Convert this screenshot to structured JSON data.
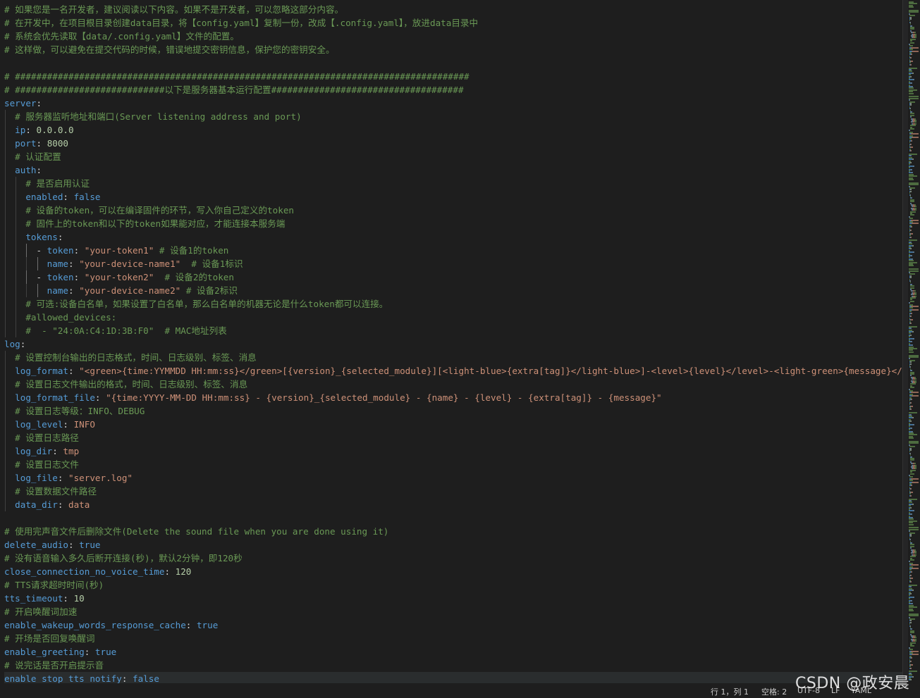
{
  "lines": [
    {
      "indent": 0,
      "guides": [],
      "tokens": [
        {
          "t": "comment",
          "v": "# 如果您是一名开发者，建议阅读以下内容。如果不是开发者，可以忽略这部分内容。"
        }
      ]
    },
    {
      "indent": 0,
      "guides": [],
      "tokens": [
        {
          "t": "comment",
          "v": "# 在开发中，在项目根目录创建data目录，将【config.yaml】复制一份，改成【.config.yaml】，放进data目录中"
        }
      ]
    },
    {
      "indent": 0,
      "guides": [],
      "tokens": [
        {
          "t": "comment",
          "v": "# 系统会优先读取【data/.config.yaml】文件的配置。"
        }
      ]
    },
    {
      "indent": 0,
      "guides": [],
      "tokens": [
        {
          "t": "comment",
          "v": "# 这样做，可以避免在提交代码的时候，错误地提交密钥信息，保护您的密钥安全。"
        }
      ]
    },
    {
      "indent": 0,
      "guides": [],
      "tokens": []
    },
    {
      "indent": 0,
      "guides": [],
      "tokens": [
        {
          "t": "comment",
          "v": "# #####################################################################################"
        }
      ]
    },
    {
      "indent": 0,
      "guides": [],
      "tokens": [
        {
          "t": "comment",
          "v": "# ############################以下是服务器基本运行配置####################################"
        }
      ]
    },
    {
      "indent": 0,
      "guides": [],
      "tokens": [
        {
          "t": "key",
          "v": "server"
        },
        {
          "t": "punct",
          "v": ":"
        }
      ]
    },
    {
      "indent": 2,
      "guides": [
        0
      ],
      "tokens": [
        {
          "t": "comment",
          "v": "# 服务器监听地址和端口(Server listening address and port)"
        }
      ]
    },
    {
      "indent": 2,
      "guides": [
        0
      ],
      "tokens": [
        {
          "t": "key",
          "v": "ip"
        },
        {
          "t": "punct",
          "v": ": "
        },
        {
          "t": "num",
          "v": "0.0.0.0"
        }
      ]
    },
    {
      "indent": 2,
      "guides": [
        0
      ],
      "tokens": [
        {
          "t": "key",
          "v": "port"
        },
        {
          "t": "punct",
          "v": ": "
        },
        {
          "t": "num",
          "v": "8000"
        }
      ]
    },
    {
      "indent": 2,
      "guides": [
        0
      ],
      "tokens": [
        {
          "t": "comment",
          "v": "# 认证配置"
        }
      ]
    },
    {
      "indent": 2,
      "guides": [
        0
      ],
      "tokens": [
        {
          "t": "key",
          "v": "auth"
        },
        {
          "t": "punct",
          "v": ":"
        }
      ]
    },
    {
      "indent": 4,
      "guides": [
        0,
        2
      ],
      "tokens": [
        {
          "t": "comment",
          "v": "# 是否启用认证"
        }
      ]
    },
    {
      "indent": 4,
      "guides": [
        0,
        2
      ],
      "tokens": [
        {
          "t": "key",
          "v": "enabled"
        },
        {
          "t": "punct",
          "v": ": "
        },
        {
          "t": "bool",
          "v": "false"
        }
      ]
    },
    {
      "indent": 4,
      "guides": [
        0,
        2
      ],
      "tokens": [
        {
          "t": "comment",
          "v": "# 设备的token，可以在编译固件的环节，写入你自己定义的token"
        }
      ]
    },
    {
      "indent": 4,
      "guides": [
        0,
        2
      ],
      "tokens": [
        {
          "t": "comment",
          "v": "# 固件上的token和以下的token如果能对应，才能连接本服务端"
        }
      ]
    },
    {
      "indent": 4,
      "guides": [
        0,
        2
      ],
      "tokens": [
        {
          "t": "key",
          "v": "tokens"
        },
        {
          "t": "punct",
          "v": ":"
        }
      ]
    },
    {
      "indent": 6,
      "guides": [
        0,
        2,
        4
      ],
      "tokens": [
        {
          "t": "dash",
          "v": "- "
        },
        {
          "t": "key",
          "v": "token"
        },
        {
          "t": "punct",
          "v": ": "
        },
        {
          "t": "str",
          "v": "\"your-token1\""
        },
        {
          "t": "comment",
          "v": " # 设备1的token"
        }
      ]
    },
    {
      "indent": 8,
      "guides": [
        0,
        2,
        4,
        6
      ],
      "tokens": [
        {
          "t": "key",
          "v": "name"
        },
        {
          "t": "punct",
          "v": ": "
        },
        {
          "t": "str",
          "v": "\"your-device-name1\""
        },
        {
          "t": "comment",
          "v": "  # 设备1标识"
        }
      ]
    },
    {
      "indent": 6,
      "guides": [
        0,
        2,
        4
      ],
      "tokens": [
        {
          "t": "dash",
          "v": "- "
        },
        {
          "t": "key",
          "v": "token"
        },
        {
          "t": "punct",
          "v": ": "
        },
        {
          "t": "str",
          "v": "\"your-token2\""
        },
        {
          "t": "comment",
          "v": "  # 设备2的token"
        }
      ]
    },
    {
      "indent": 8,
      "guides": [
        0,
        2,
        4,
        6
      ],
      "tokens": [
        {
          "t": "key",
          "v": "name"
        },
        {
          "t": "punct",
          "v": ": "
        },
        {
          "t": "str",
          "v": "\"your-device-name2\""
        },
        {
          "t": "comment",
          "v": " # 设备2标识"
        }
      ]
    },
    {
      "indent": 4,
      "guides": [
        0,
        2
      ],
      "tokens": [
        {
          "t": "comment",
          "v": "# 可选:设备白名单，如果设置了白名单，那么白名单的机器无论是什么token都可以连接。"
        }
      ]
    },
    {
      "indent": 4,
      "guides": [
        0,
        2
      ],
      "tokens": [
        {
          "t": "comment",
          "v": "#allowed_devices:"
        }
      ]
    },
    {
      "indent": 4,
      "guides": [
        0,
        2
      ],
      "tokens": [
        {
          "t": "comment",
          "v": "#  - \"24:0A:C4:1D:3B:F0\"  # MAC地址列表"
        }
      ]
    },
    {
      "indent": 0,
      "guides": [],
      "tokens": [
        {
          "t": "key",
          "v": "log"
        },
        {
          "t": "punct",
          "v": ":"
        }
      ]
    },
    {
      "indent": 2,
      "guides": [
        0
      ],
      "tokens": [
        {
          "t": "comment",
          "v": "# 设置控制台输出的日志格式，时间、日志级别、标签、消息"
        }
      ]
    },
    {
      "indent": 2,
      "guides": [
        0
      ],
      "tokens": [
        {
          "t": "key",
          "v": "log_format"
        },
        {
          "t": "punct",
          "v": ": "
        },
        {
          "t": "str",
          "v": "\"<green>{time:YYMMDD HH:mm:ss}</green>[{version}_{selected_module}][<light-blue>{extra[tag]}</light-blue>]-<level>{level}</level>-<light-green>{message}</light-green>\""
        }
      ]
    },
    {
      "indent": 2,
      "guides": [
        0
      ],
      "tokens": [
        {
          "t": "comment",
          "v": "# 设置日志文件输出的格式，时间、日志级别、标签、消息"
        }
      ]
    },
    {
      "indent": 2,
      "guides": [
        0
      ],
      "tokens": [
        {
          "t": "key",
          "v": "log_format_file"
        },
        {
          "t": "punct",
          "v": ": "
        },
        {
          "t": "str",
          "v": "\"{time:YYYY-MM-DD HH:mm:ss} - {version}_{selected_module} - {name} - {level} - {extra[tag]} - {message}\""
        }
      ]
    },
    {
      "indent": 2,
      "guides": [
        0
      ],
      "tokens": [
        {
          "t": "comment",
          "v": "# 设置日志等级：INFO、DEBUG"
        }
      ]
    },
    {
      "indent": 2,
      "guides": [
        0
      ],
      "tokens": [
        {
          "t": "key",
          "v": "log_level"
        },
        {
          "t": "punct",
          "v": ": "
        },
        {
          "t": "str",
          "v": "INFO"
        }
      ]
    },
    {
      "indent": 2,
      "guides": [
        0
      ],
      "tokens": [
        {
          "t": "comment",
          "v": "# 设置日志路径"
        }
      ]
    },
    {
      "indent": 2,
      "guides": [
        0
      ],
      "tokens": [
        {
          "t": "key",
          "v": "log_dir"
        },
        {
          "t": "punct",
          "v": ": "
        },
        {
          "t": "str",
          "v": "tmp"
        }
      ]
    },
    {
      "indent": 2,
      "guides": [
        0
      ],
      "tokens": [
        {
          "t": "comment",
          "v": "# 设置日志文件"
        }
      ]
    },
    {
      "indent": 2,
      "guides": [
        0
      ],
      "tokens": [
        {
          "t": "key",
          "v": "log_file"
        },
        {
          "t": "punct",
          "v": ": "
        },
        {
          "t": "str",
          "v": "\"server.log\""
        }
      ]
    },
    {
      "indent": 2,
      "guides": [
        0
      ],
      "tokens": [
        {
          "t": "comment",
          "v": "# 设置数据文件路径"
        }
      ]
    },
    {
      "indent": 2,
      "guides": [
        0
      ],
      "tokens": [
        {
          "t": "key",
          "v": "data_dir"
        },
        {
          "t": "punct",
          "v": ": "
        },
        {
          "t": "str",
          "v": "data"
        }
      ]
    },
    {
      "indent": 0,
      "guides": [],
      "tokens": []
    },
    {
      "indent": 0,
      "guides": [],
      "tokens": [
        {
          "t": "comment",
          "v": "# 使用完声音文件后删除文件(Delete the sound file when you are done using it)"
        }
      ]
    },
    {
      "indent": 0,
      "guides": [],
      "tokens": [
        {
          "t": "key",
          "v": "delete_audio"
        },
        {
          "t": "punct",
          "v": ": "
        },
        {
          "t": "bool",
          "v": "true"
        }
      ]
    },
    {
      "indent": 0,
      "guides": [],
      "tokens": [
        {
          "t": "comment",
          "v": "# 没有语音输入多久后断开连接(秒)，默认2分钟，即120秒"
        }
      ]
    },
    {
      "indent": 0,
      "guides": [],
      "tokens": [
        {
          "t": "key",
          "v": "close_connection_no_voice_time"
        },
        {
          "t": "punct",
          "v": ": "
        },
        {
          "t": "num",
          "v": "120"
        }
      ]
    },
    {
      "indent": 0,
      "guides": [],
      "tokens": [
        {
          "t": "comment",
          "v": "# TTS请求超时时间(秒)"
        }
      ]
    },
    {
      "indent": 0,
      "guides": [],
      "tokens": [
        {
          "t": "key",
          "v": "tts_timeout"
        },
        {
          "t": "punct",
          "v": ": "
        },
        {
          "t": "num",
          "v": "10"
        }
      ]
    },
    {
      "indent": 0,
      "guides": [],
      "tokens": [
        {
          "t": "comment",
          "v": "# 开启唤醒词加速"
        }
      ]
    },
    {
      "indent": 0,
      "guides": [],
      "tokens": [
        {
          "t": "key",
          "v": "enable_wakeup_words_response_cache"
        },
        {
          "t": "punct",
          "v": ": "
        },
        {
          "t": "bool",
          "v": "true"
        }
      ]
    },
    {
      "indent": 0,
      "guides": [],
      "tokens": [
        {
          "t": "comment",
          "v": "# 开场是否回复唤醒词"
        }
      ]
    },
    {
      "indent": 0,
      "guides": [],
      "tokens": [
        {
          "t": "key",
          "v": "enable_greeting"
        },
        {
          "t": "punct",
          "v": ": "
        },
        {
          "t": "bool",
          "v": "true"
        }
      ]
    },
    {
      "indent": 0,
      "guides": [],
      "tokens": [
        {
          "t": "comment",
          "v": "# 说完话是否开启提示音"
        }
      ]
    },
    {
      "indent": 0,
      "guides": [],
      "cursor": true,
      "tokens": [
        {
          "t": "key",
          "v": "enable_stop_tts_notify"
        },
        {
          "t": "punct",
          "v": ": "
        },
        {
          "t": "bool",
          "v": "false"
        }
      ]
    }
  ],
  "statusbar": {
    "position": "行 1，列 1",
    "spaces": "空格: 2",
    "encoding": "UTF-8",
    "eol": "LF",
    "language": "YAML"
  },
  "watermark": "CSDN @政安晨",
  "colors": {
    "background": "#1e1e1e",
    "comment": "#6a9955",
    "key": "#569cd6",
    "string": "#ce9178",
    "number": "#b5cea8"
  }
}
